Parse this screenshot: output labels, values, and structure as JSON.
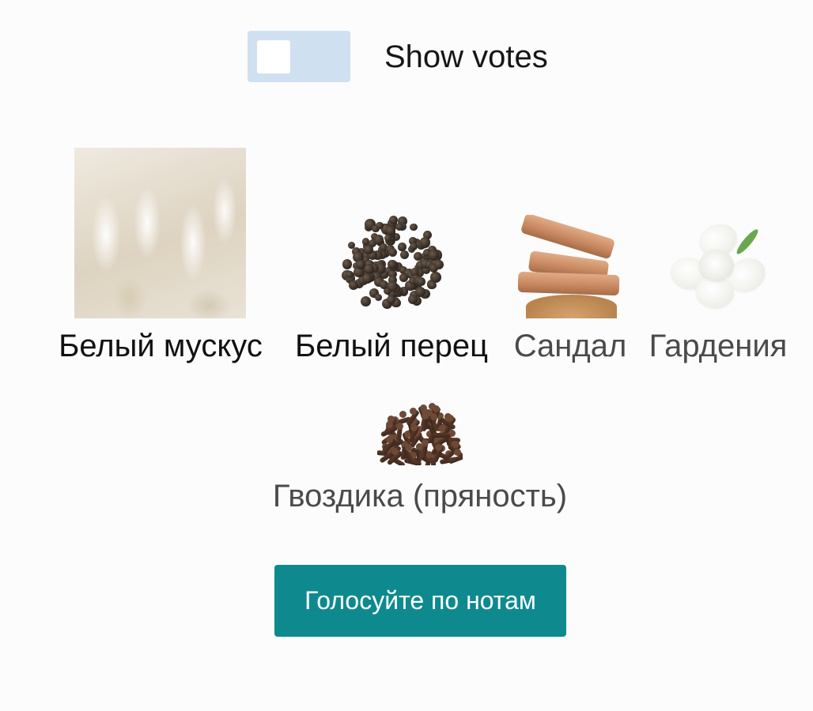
{
  "toggle": {
    "label": "Show votes",
    "checked": false
  },
  "notes": [
    {
      "name": "Белый мускус",
      "icon": "white-musk-image"
    },
    {
      "name": "Белый перец",
      "icon": "white-pepper-image"
    },
    {
      "name": "Сандал",
      "icon": "sandalwood-image"
    },
    {
      "name": "Гардения",
      "icon": "gardenia-image"
    },
    {
      "name": "Гвоздика (пряность)",
      "icon": "clove-image"
    }
  ],
  "vote_button": {
    "label": "Голосуйте по нотам"
  },
  "colors": {
    "toggle_background": "#cfe1f1",
    "button_background": "#0e8a8e",
    "button_text": "#ffffff"
  }
}
